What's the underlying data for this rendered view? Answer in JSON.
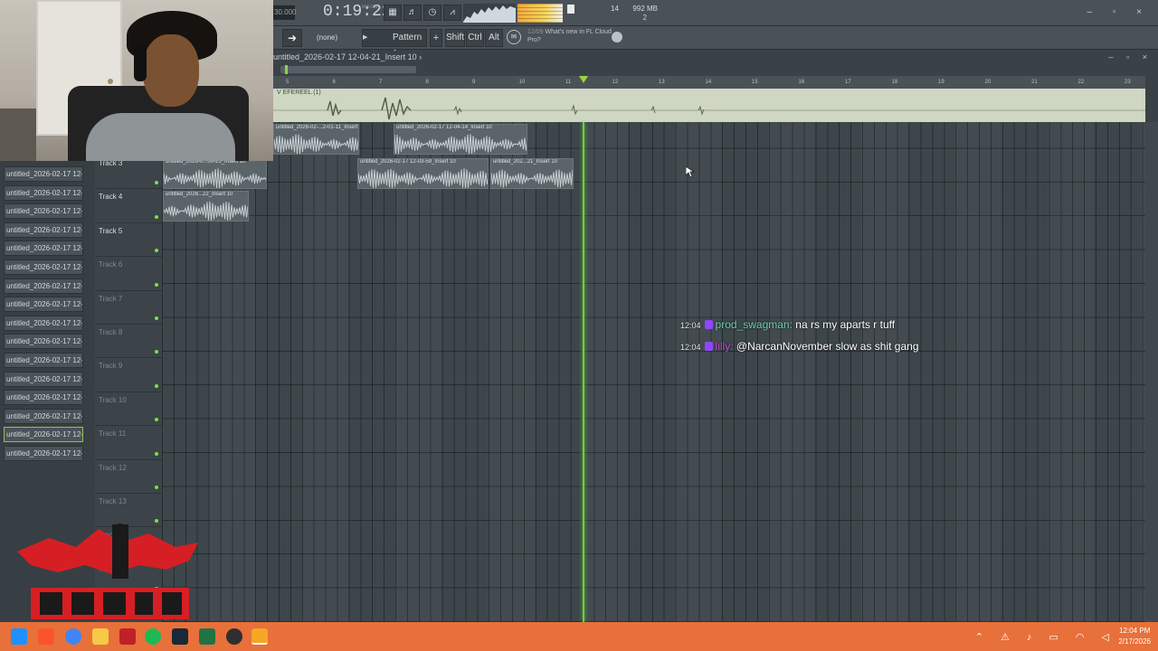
{
  "topbar": {
    "tempo": "30.000",
    "time": "0:19:22",
    "time_label": "M:S:CS",
    "cpu": "14",
    "memory": "992 MB",
    "polyphony": "2",
    "window_controls": "– ▫ ×"
  },
  "toolbar2": {
    "arrow": "➜",
    "snap": "(none)",
    "pattern": "Pattern 1",
    "pattern_add": "+",
    "shift": "Shift",
    "ctrl": "Ctrl",
    "alt": "Alt",
    "news_date": "12/09",
    "news_text": "What's new in FL Cloud Pro?"
  },
  "playlist": {
    "title": "untitled_2026-02-17 12-04-21_Insert 10 ›",
    "title_controls": "– ▫ ×",
    "master_label": "V EFEREEL (1)",
    "ruler": [
      "5",
      "6",
      "7",
      "8",
      "9",
      "10",
      "11",
      "12",
      "13",
      "14",
      "15",
      "16",
      "17",
      "18",
      "19",
      "20",
      "21",
      "22",
      "23"
    ],
    "tracks": [
      {
        "name": "Track 3",
        "dim": false
      },
      {
        "name": "Track 4",
        "dim": false
      },
      {
        "name": "Track 5",
        "dim": false
      },
      {
        "name": "Track 6",
        "dim": true
      },
      {
        "name": "Track 7",
        "dim": true
      },
      {
        "name": "Track 8",
        "dim": true
      },
      {
        "name": "Track 9",
        "dim": true
      },
      {
        "name": "Track 10",
        "dim": true
      },
      {
        "name": "Track 11",
        "dim": true
      },
      {
        "name": "Track 12",
        "dim": true
      },
      {
        "name": "Track 13",
        "dim": true
      },
      {
        "name": "Track 14",
        "dim": true
      },
      {
        "name": "Track 15",
        "dim": true
      }
    ],
    "clips": [
      {
        "name": "untitled_2026-02-...2-01-11_Insert 10"
      },
      {
        "name": "untitled_2026-02-17 12-04-14_Insert 10"
      },
      {
        "name": "untitled_2026-0...00-25_Insert 10"
      },
      {
        "name": "untitled_2026-02-17 12-03-59_Insert 10"
      },
      {
        "name": "untitled_202...21_Insert 10"
      },
      {
        "name": "untitled_2026...22_Insert 10"
      }
    ]
  },
  "picker": {
    "items": [
      "untitled_2026-02-17 12-...",
      "untitled_2026-02-17 12-...",
      "untitled_2026-02-17 12-...",
      "untitled_2026-02-17 12-...",
      "untitled_2026-02-17 12-...",
      "untitled_2026-02-17 12-...",
      "untitled_2026-02-17 12-...",
      "untitled_2026-02-17 12-...",
      "untitled_2026-02-17 12-...",
      "untitled_2026-02-17 12-...",
      "untitled_2026-02-17 12-...",
      "untitled_2026-02-17 12-...",
      "untitled_2026-02-17 12-...",
      "untitled_2026-02-17 12-...",
      "untitled_2026-02-17 12-...",
      "untitled_2026-02-17 12-..."
    ],
    "selected_index": 14
  },
  "chat": [
    {
      "time": "12:04",
      "user": "prod_swagman",
      "sep": ":",
      "message": "na rs my aparts r tuff"
    },
    {
      "time": "12:04",
      "user": "lilly",
      "sep": ":",
      "message": "@NarcanNovember slow as shit gang"
    }
  ],
  "taskbar": {
    "time": "12:04 PM",
    "date": "2/17/2026",
    "tray_icons": [
      "chevron-up-icon",
      "network-icon",
      "mic-icon",
      "display-icon",
      "wifi-icon",
      "volume-icon"
    ],
    "icons": [
      "windows-icon",
      "brave-icon",
      "chrome-icon",
      "misc-app-icon",
      "video-editor-icon",
      "spotify-icon",
      "steam-icon",
      "excel-icon",
      "obs-icon",
      "fl-studio-icon"
    ],
    "accent": "#e8703a"
  },
  "colors": {
    "playhead": "#6bd23a",
    "chat_user1": "#6fd0b4",
    "chat_user2": "#c44fd0",
    "twitch_badge": "#9146ff"
  }
}
